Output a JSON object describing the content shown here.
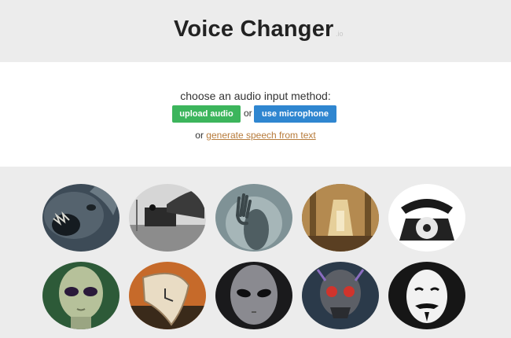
{
  "header": {
    "title": "Voice Changer",
    "title_suffix": ".io"
  },
  "input_panel": {
    "prompt": "choose an audio input method:",
    "upload_label": "upload audio",
    "or_text": "or",
    "microphone_label": "use microphone",
    "alt_prefix": "or",
    "tts_link": "generate speech from text"
  },
  "voices": [
    {
      "icon": "screaming-creature-icon"
    },
    {
      "icon": "gramophone-horn-icon"
    },
    {
      "icon": "ghost-hand-icon"
    },
    {
      "icon": "cathedral-interior-icon"
    },
    {
      "icon": "rotary-telephone-icon"
    },
    {
      "icon": "alien-icon"
    },
    {
      "icon": "melting-clock-icon"
    },
    {
      "icon": "grey-alien-icon"
    },
    {
      "icon": "robot-skull-icon"
    },
    {
      "icon": "anonymous-mask-icon"
    }
  ],
  "colors": {
    "upload": "#3cb55c",
    "microphone": "#2f86d0",
    "link": "#b77b3b",
    "band": "#ececec"
  }
}
